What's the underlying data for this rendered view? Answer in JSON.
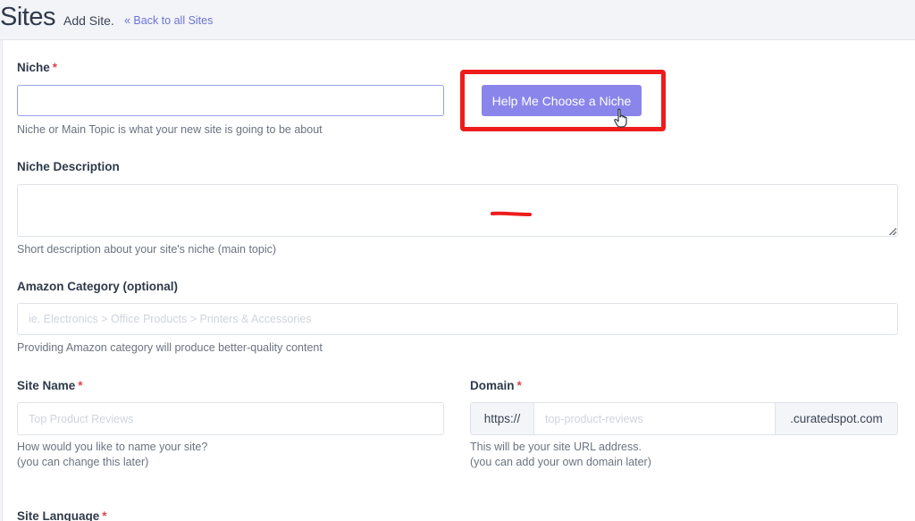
{
  "header": {
    "title": "Sites",
    "subtitle": "Add Site.",
    "back_link": "« Back to all Sites"
  },
  "form": {
    "niche": {
      "label": "Niche",
      "required_mark": "*",
      "value": "",
      "help": "Niche or Main Topic is what your new site is going to be about",
      "help_button": "Help Me Choose a Niche"
    },
    "niche_description": {
      "label": "Niche Description",
      "value": "",
      "help": "Short description about your site's niche (main topic)"
    },
    "amazon_category": {
      "label": "Amazon Category (optional)",
      "placeholder": "ie. Electronics > Office Products > Printers & Accessories",
      "help": "Providing Amazon category will produce better-quality content"
    },
    "site_name": {
      "label": "Site Name",
      "required_mark": "*",
      "placeholder": "Top Product Reviews",
      "help_line1": "How would you like to name your site?",
      "help_line2": "(you can change this later)"
    },
    "domain": {
      "label": "Domain",
      "required_mark": "*",
      "prefix": "https://",
      "placeholder": "top-product-reviews",
      "suffix": ".curatedspot.com",
      "help_line1": "This will be your site URL address.",
      "help_line2": "(you can add your own domain later)"
    },
    "site_language": {
      "label": "Site Language",
      "required_mark": "*"
    }
  },
  "annotations": {
    "highlight_color": "#ee1c1c",
    "button_color": "#8a85ea"
  }
}
